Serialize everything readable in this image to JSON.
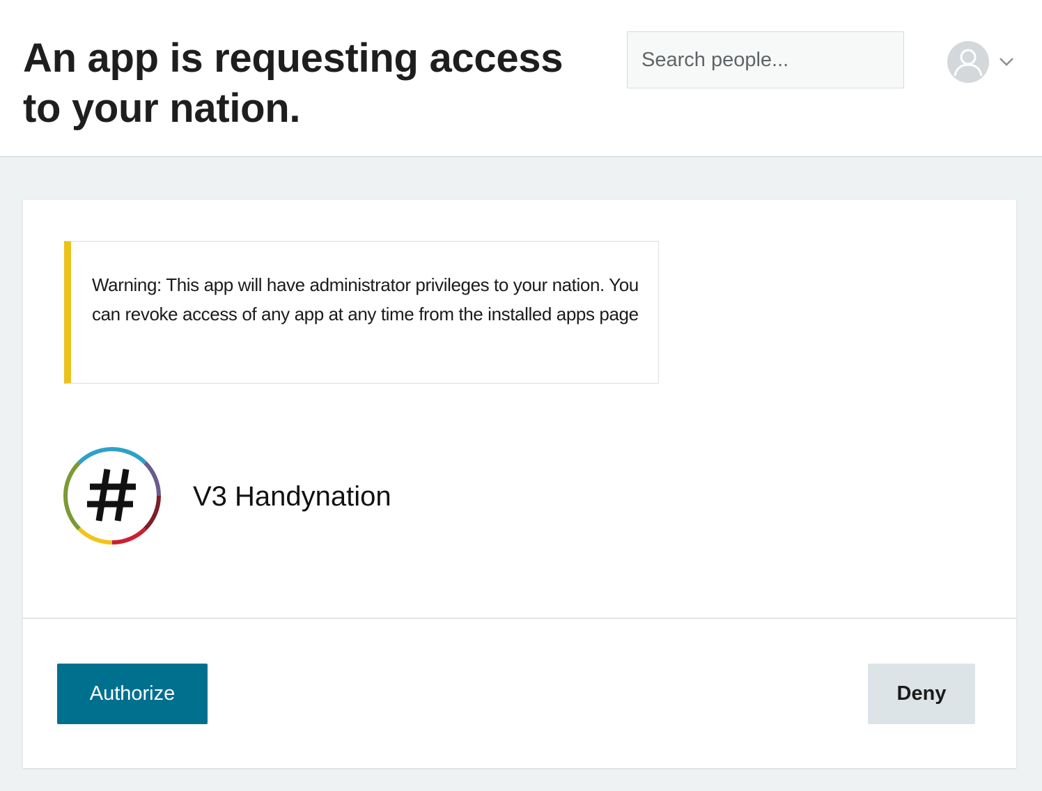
{
  "header": {
    "title": "An app is requesting access to your nation.",
    "search": {
      "placeholder": "Search people...",
      "value": ""
    },
    "user_menu": {
      "avatar_icon": "user-avatar-icon",
      "chevron_icon": "chevron-down-icon"
    }
  },
  "card": {
    "warning": {
      "text": "Warning: This app will have administrator privileges to your nation. You can revoke access of any app at any time from the installed apps page",
      "accent_color": "#ecc21a"
    },
    "app": {
      "name": "V3 Handynation",
      "logo_icon": "hashtag-logo-icon"
    },
    "actions": {
      "authorize_label": "Authorize",
      "deny_label": "Deny"
    }
  },
  "colors": {
    "primary": "#00708f",
    "secondary": "#dde4e7",
    "background": "#eff2f3",
    "warning_accent": "#ecc21a"
  }
}
